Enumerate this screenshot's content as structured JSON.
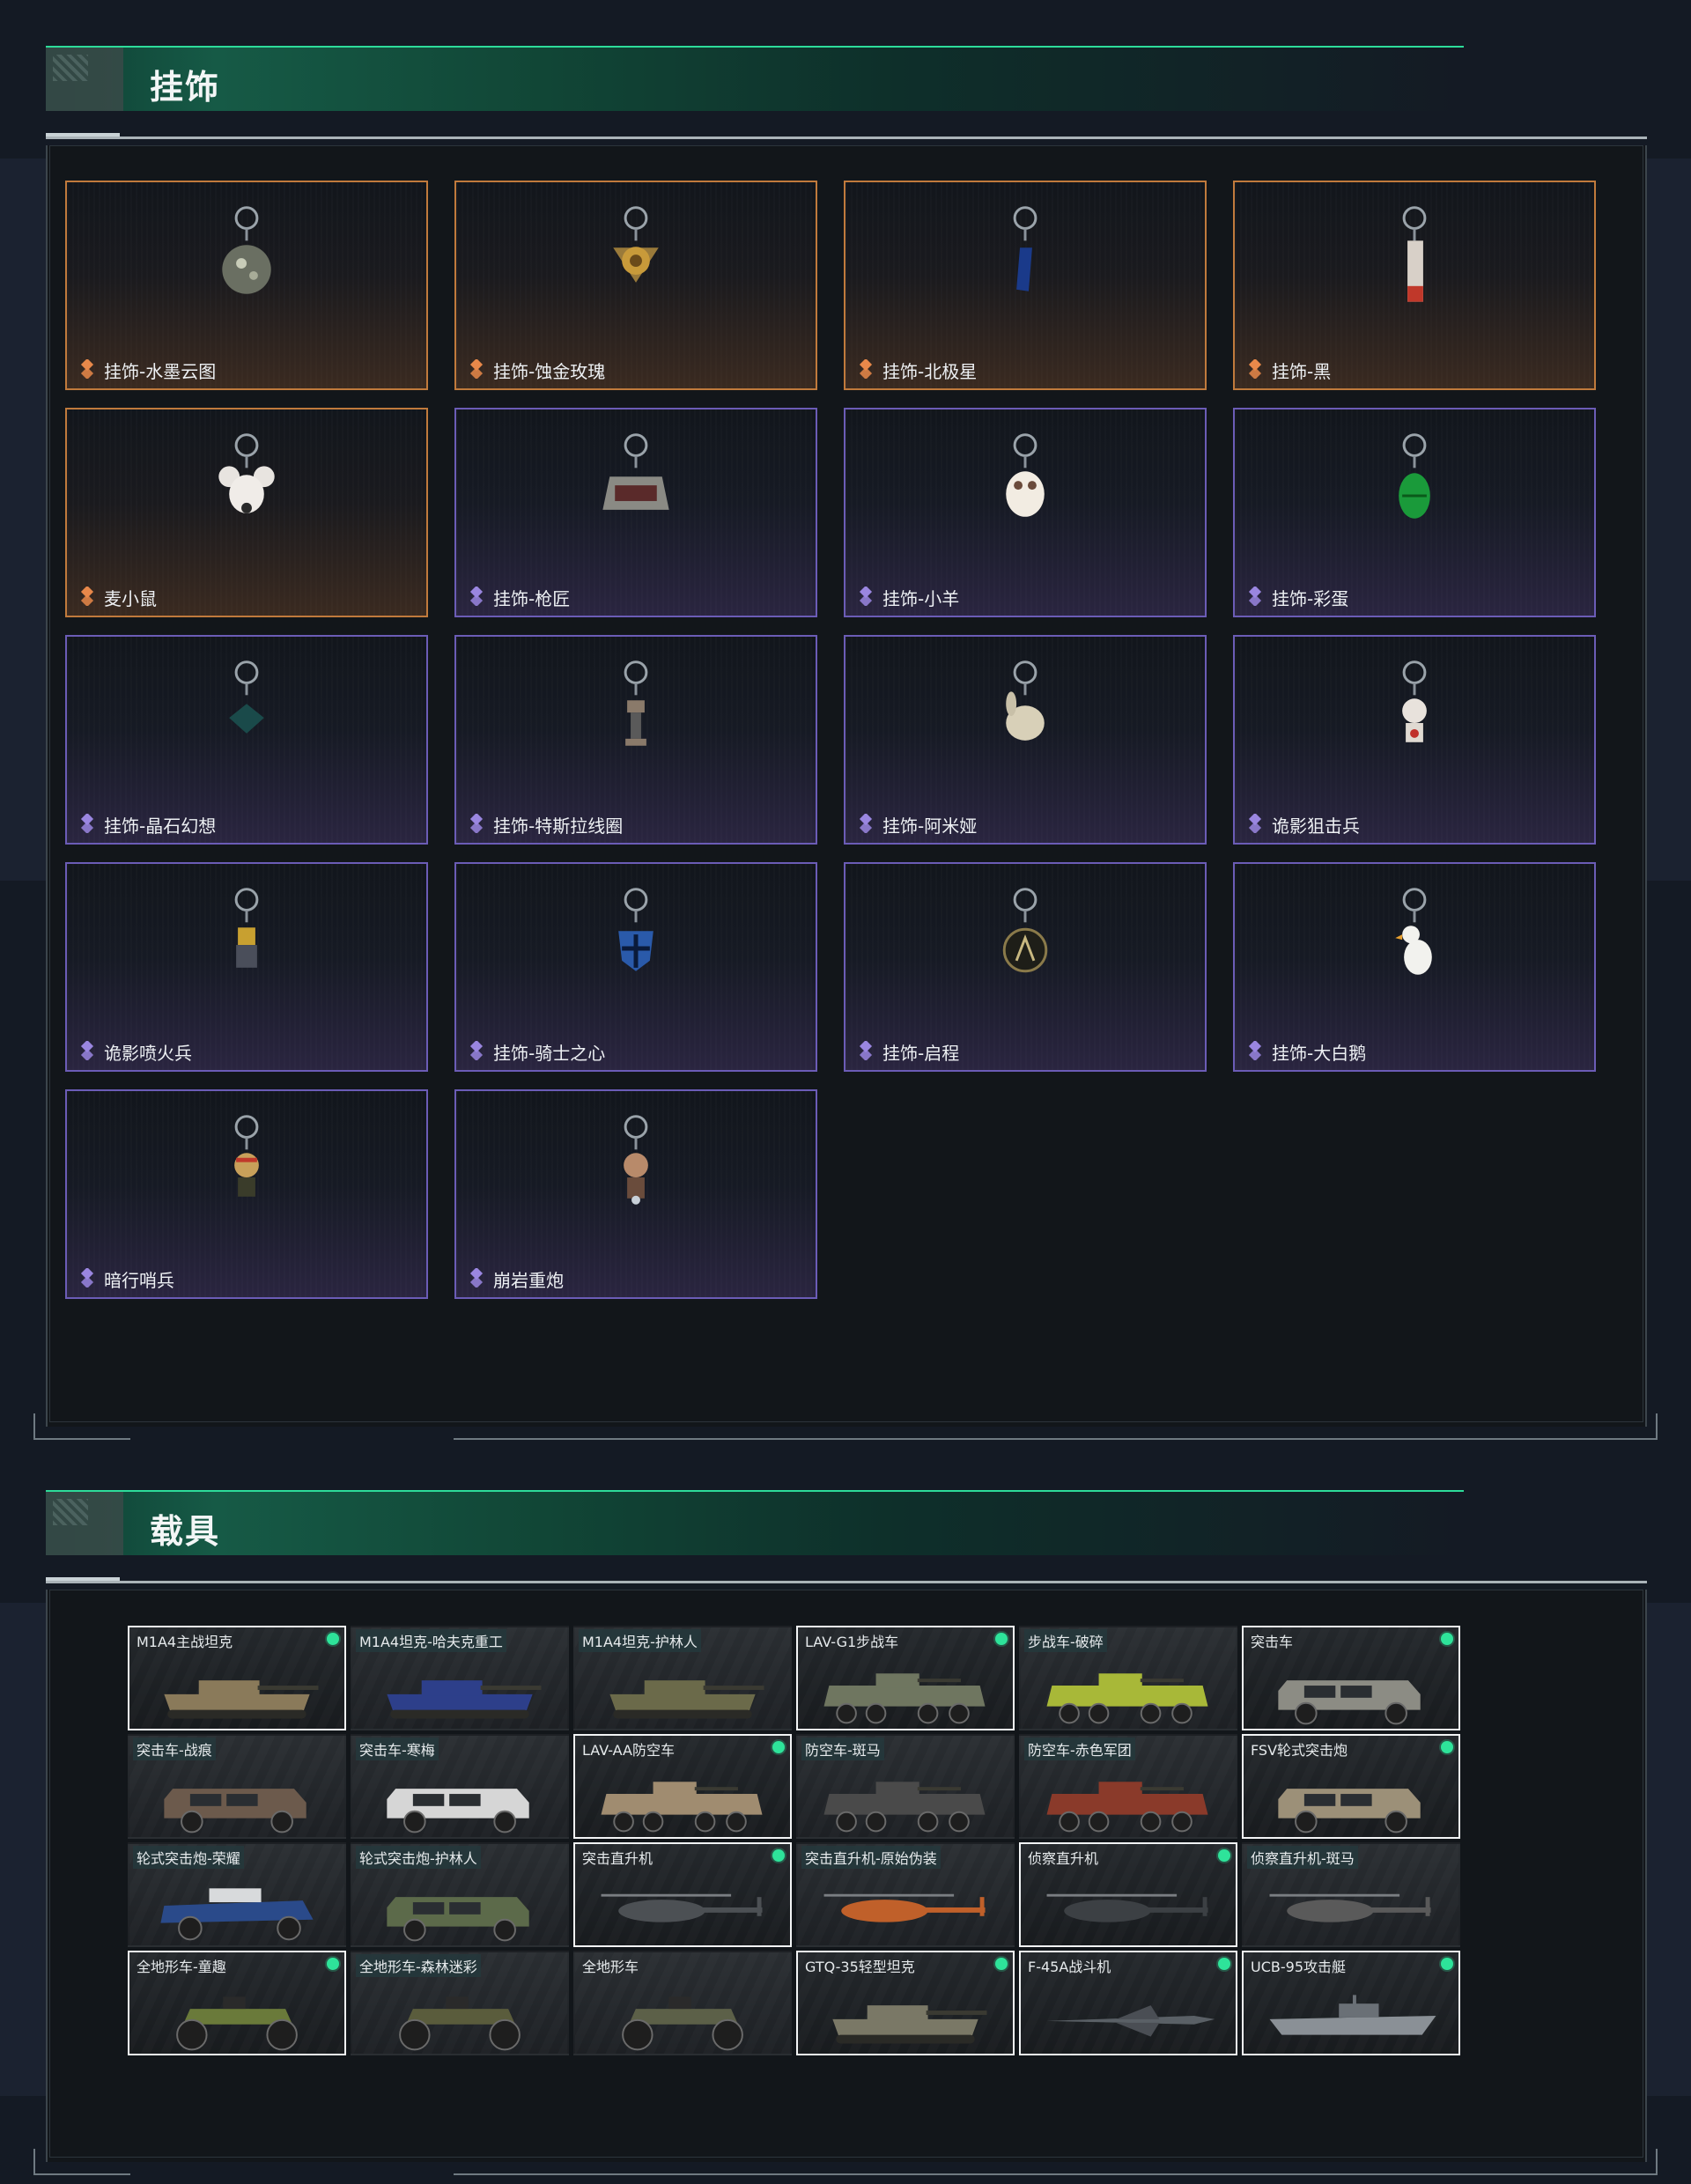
{
  "charms_section": {
    "title": "挂饰",
    "items": [
      {
        "name": "挂饰-水墨云图",
        "rarity": "gold",
        "art": "disco-ball-charm"
      },
      {
        "name": "挂饰-蚀金玫瑰",
        "rarity": "gold",
        "art": "gold-rose-charm"
      },
      {
        "name": "挂饰-北极星",
        "rarity": "gold",
        "art": "blue-star-charm"
      },
      {
        "name": "挂饰-黑",
        "rarity": "gold",
        "art": "tag-charm"
      },
      {
        "name": "麦小鼠",
        "rarity": "gold",
        "art": "mouse-charm"
      },
      {
        "name": "挂饰-枪匠",
        "rarity": "purple",
        "art": "toolbox-charm"
      },
      {
        "name": "挂饰-小羊",
        "rarity": "purple",
        "art": "sheep-charm"
      },
      {
        "name": "挂饰-彩蛋",
        "rarity": "purple",
        "art": "green-egg-charm"
      },
      {
        "name": "挂饰-晶石幻想",
        "rarity": "purple",
        "art": "crystal-cube-charm"
      },
      {
        "name": "挂饰-特斯拉线圈",
        "rarity": "purple",
        "art": "tesla-coil-charm"
      },
      {
        "name": "挂饰-阿米娅",
        "rarity": "purple",
        "art": "bunny-charm"
      },
      {
        "name": "诡影狙击兵",
        "rarity": "purple",
        "art": "sniper-figure-charm"
      },
      {
        "name": "诡影喷火兵",
        "rarity": "purple",
        "art": "flamer-figure-charm"
      },
      {
        "name": "挂饰-骑士之心",
        "rarity": "purple",
        "art": "blue-shield-charm"
      },
      {
        "name": "挂饰-启程",
        "rarity": "purple",
        "art": "medallion-charm"
      },
      {
        "name": "挂饰-大白鹅",
        "rarity": "purple",
        "art": "goose-charm"
      },
      {
        "name": "暗行哨兵",
        "rarity": "purple",
        "art": "sentinel-figure-charm"
      },
      {
        "name": "崩岩重炮",
        "rarity": "purple",
        "art": "heavy-figure-charm"
      }
    ]
  },
  "vehicles_section": {
    "title": "载具",
    "items": [
      {
        "name": "M1A4主战坦克",
        "selected": true,
        "owned": true,
        "tagged": false,
        "kind": "tank",
        "color": "#8a7a5a"
      },
      {
        "name": "M1A4坦克-哈夫克重工",
        "selected": false,
        "owned": false,
        "tagged": true,
        "kind": "tank",
        "color": "#2d3f8a"
      },
      {
        "name": "M1A4坦克-护林人",
        "selected": false,
        "owned": false,
        "tagged": true,
        "kind": "tank",
        "color": "#6b6a4a"
      },
      {
        "name": "LAV-G1步战车",
        "selected": true,
        "owned": true,
        "tagged": false,
        "kind": "apc",
        "color": "#6f7660"
      },
      {
        "name": "步战车-破碎",
        "selected": false,
        "owned": false,
        "tagged": true,
        "kind": "apc",
        "color": "#a8b838"
      },
      {
        "name": "突击车",
        "selected": true,
        "owned": true,
        "tagged": false,
        "kind": "truck",
        "color": "#8c8c84"
      },
      {
        "name": "突击车-战痕",
        "selected": false,
        "owned": false,
        "tagged": true,
        "kind": "truck",
        "color": "#6c5a4c"
      },
      {
        "name": "突击车-寒梅",
        "selected": false,
        "owned": false,
        "tagged": true,
        "kind": "truck",
        "color": "#d6d6d6"
      },
      {
        "name": "LAV-AA防空车",
        "selected": true,
        "owned": true,
        "tagged": false,
        "kind": "apc",
        "color": "#a08c70"
      },
      {
        "name": "防空车-斑马",
        "selected": false,
        "owned": false,
        "tagged": true,
        "kind": "apc",
        "color": "#4a4a4a"
      },
      {
        "name": "防空车-赤色军团",
        "selected": false,
        "owned": false,
        "tagged": true,
        "kind": "apc",
        "color": "#8a3a2a"
      },
      {
        "name": "FSV轮式突击炮",
        "selected": true,
        "owned": true,
        "tagged": false,
        "kind": "truck",
        "color": "#9c9078"
      },
      {
        "name": "轮式突击炮-荣耀",
        "selected": false,
        "owned": false,
        "tagged": true,
        "kind": "buggy",
        "color": "#2a4a8a"
      },
      {
        "name": "轮式突击炮-护林人",
        "selected": false,
        "owned": false,
        "tagged": true,
        "kind": "truck",
        "color": "#5c6a4a"
      },
      {
        "name": "突击直升机",
        "selected": true,
        "owned": true,
        "tagged": false,
        "kind": "heli",
        "color": "#4c5054"
      },
      {
        "name": "突击直升机-原始伪装",
        "selected": false,
        "owned": false,
        "tagged": true,
        "kind": "heli",
        "color": "#c0602a"
      },
      {
        "name": "侦察直升机",
        "selected": true,
        "owned": true,
        "tagged": false,
        "kind": "heli",
        "color": "#3c4044"
      },
      {
        "name": "侦察直升机-斑马",
        "selected": false,
        "owned": false,
        "tagged": true,
        "kind": "heli",
        "color": "#5a5a5a"
      },
      {
        "name": "全地形车-童趣",
        "selected": true,
        "owned": true,
        "tagged": false,
        "kind": "atv",
        "color": "#6a7a3a"
      },
      {
        "name": "全地形车-森林迷彩",
        "selected": false,
        "owned": false,
        "tagged": true,
        "kind": "atv",
        "color": "#5a5c3c"
      },
      {
        "name": "全地形车",
        "selected": false,
        "owned": false,
        "tagged": false,
        "kind": "atv",
        "color": "#5c6048"
      },
      {
        "name": "GTQ-35轻型坦克",
        "selected": true,
        "owned": true,
        "tagged": false,
        "kind": "tank",
        "color": "#7a7866"
      },
      {
        "name": "F-45A战斗机",
        "selected": true,
        "owned": true,
        "tagged": false,
        "kind": "jet",
        "color": "#5a6066"
      },
      {
        "name": "UCB-95攻击艇",
        "selected": true,
        "owned": true,
        "tagged": false,
        "kind": "boat",
        "color": "#8a9096"
      }
    ]
  },
  "colors": {
    "accent_green": "#2ddc9a",
    "rarity_gold": "#c07a3c",
    "rarity_purple": "#6b5cb6",
    "owned_dot": "#2ee39a"
  }
}
